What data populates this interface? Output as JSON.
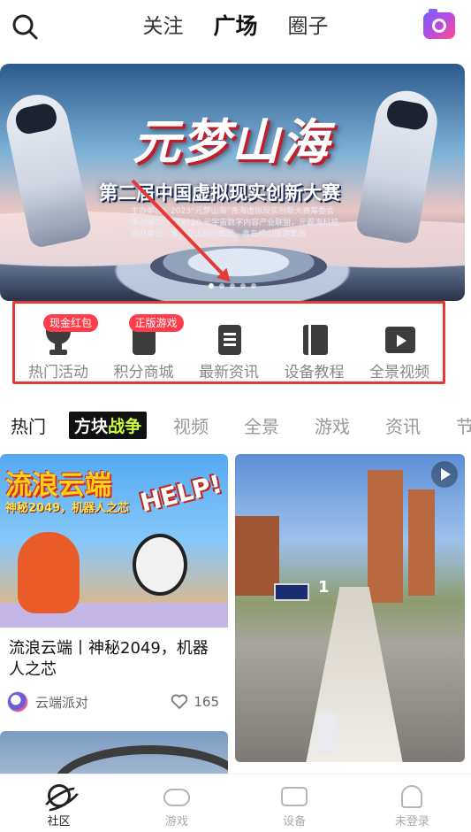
{
  "top_nav": {
    "tabs": [
      "关注",
      "广场",
      "圈子"
    ],
    "active_tab": "广场",
    "search_icon": "search-icon",
    "camera_icon": "camera-icon",
    "camera_gradient": [
      "#7b5cff",
      "#ff4f8a"
    ]
  },
  "banner": {
    "title": "元梦山海",
    "subtitle": "第二届中国虚拟现实创新大赛",
    "org_lines": [
      "主办单位：2023“元梦山海”青海虚拟现实创新大赛筹委会",
      "承办单位：878720 元宇宙数字内容产业联盟，元霸海科技",
      "协办单位：青海花山科创集团，青岛崂山旅游集团"
    ],
    "slide_count": 5,
    "active_slide": 0
  },
  "shortcuts": [
    {
      "label": "热门活动",
      "icon": "trophy-icon",
      "badge": "现金红包"
    },
    {
      "label": "积分商城",
      "icon": "shopping-bag-icon",
      "badge": "正版游戏"
    },
    {
      "label": "最新资讯",
      "icon": "news-doc-icon",
      "badge": ""
    },
    {
      "label": "设备教程",
      "icon": "book-icon",
      "badge": ""
    },
    {
      "label": "全景视频",
      "icon": "video-play-icon",
      "badge": ""
    }
  ],
  "categories": {
    "first": "热门",
    "brand": {
      "part1": "方块",
      "part2": "战争"
    },
    "items": [
      "视频",
      "全景",
      "游戏",
      "资讯",
      "节奏"
    ]
  },
  "feed": [
    {
      "thumb_title": "流浪云端",
      "thumb_subtitle": "神秘2049，机器人之芯",
      "thumb_sign": "HELP!",
      "title": "流浪云端丨神秘2049，机器人之芯",
      "author": "云端派对",
      "likes": "165"
    },
    {
      "score_text": "1",
      "has_play": true
    }
  ],
  "bottom_nav": [
    {
      "label": "社区",
      "icon": "planet-icon",
      "active": true
    },
    {
      "label": "游戏",
      "icon": "gamepad-icon",
      "active": false
    },
    {
      "label": "设备",
      "icon": "vr-device-icon",
      "active": false
    },
    {
      "label": "未登录",
      "icon": "user-ghost-icon",
      "active": false
    }
  ],
  "colors": {
    "highlight_red": "#e53935",
    "badge_red": "#ff3d4a",
    "brand_green": "#c9ff3a"
  }
}
